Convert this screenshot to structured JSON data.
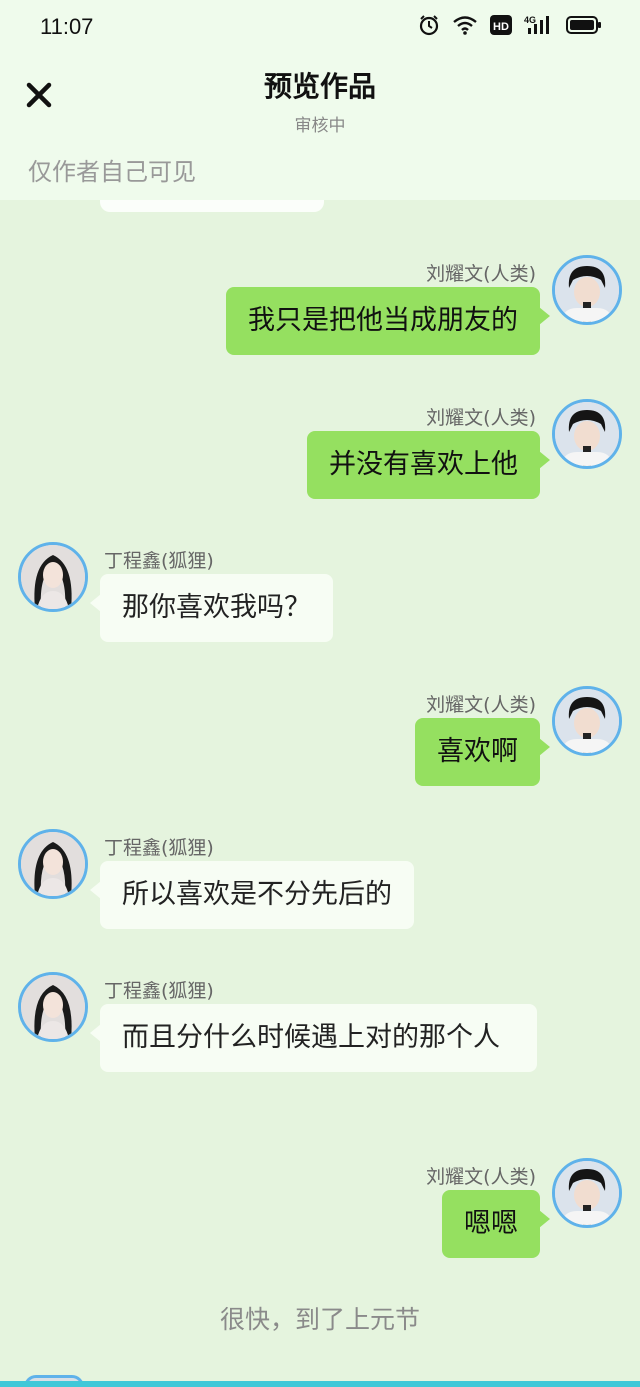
{
  "status_bar": {
    "time": "11:07",
    "icons": [
      "alarm-icon",
      "wifi-icon",
      "hd-icon",
      "4g-signal-icon",
      "battery-icon"
    ],
    "network_label": "4G",
    "hd_label": "HD"
  },
  "header": {
    "title": "预览作品",
    "subtitle": "审核中",
    "visibility_note": "仅作者自己可见",
    "close_icon": "close-icon"
  },
  "colors": {
    "background": "#e5f4de",
    "header_background": "#effbec",
    "right_bubble": "#95e060",
    "left_bubble": "#f7fdf4",
    "avatar_border": "#5fb2ea"
  },
  "messages": [
    {
      "side": "right",
      "name": "刘耀文(人类)",
      "text": "我只是把他当成朋友的"
    },
    {
      "side": "right",
      "name": "刘耀文(人类)",
      "text": "并没有喜欢上他"
    },
    {
      "side": "left",
      "name": "丁程鑫(狐狸)",
      "text": "那你喜欢我吗？"
    },
    {
      "side": "right",
      "name": "刘耀文(人类)",
      "text": "喜欢啊"
    },
    {
      "side": "left",
      "name": "丁程鑫(狐狸)",
      "text": "所以喜欢是不分先后的"
    },
    {
      "side": "left",
      "name": "丁程鑫(狐狸)",
      "text": "而且分什么时候遇上对的那个人"
    },
    {
      "side": "right",
      "name": "刘耀文(人类)",
      "text": "嗯嗯"
    }
  ],
  "narration": "很快，到了上元节"
}
